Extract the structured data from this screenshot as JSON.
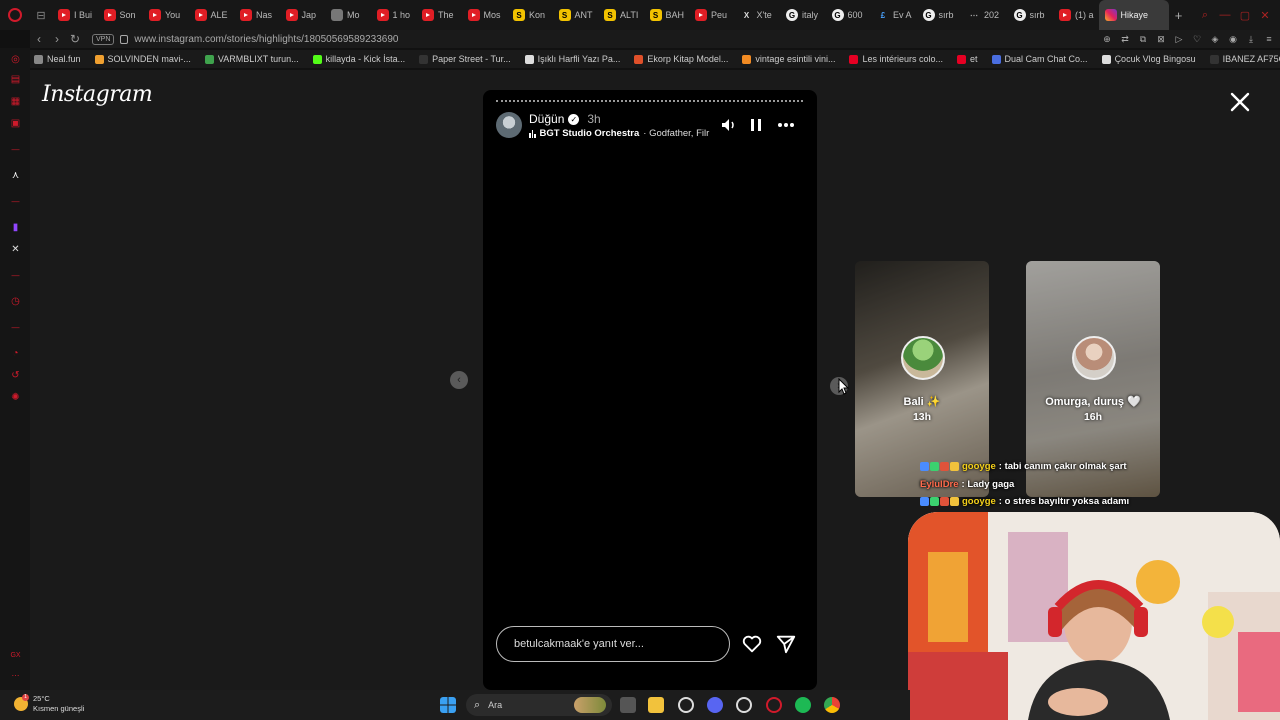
{
  "browser": {
    "tabs": [
      {
        "icon": "youtube-icon",
        "label": "I Bui"
      },
      {
        "icon": "youtube-icon",
        "label": "Son"
      },
      {
        "icon": "youtube-icon",
        "label": "You"
      },
      {
        "icon": "youtube-icon",
        "label": "ALE"
      },
      {
        "icon": "youtube-icon",
        "label": "Nas"
      },
      {
        "icon": "youtube-icon",
        "label": "Jap"
      },
      {
        "icon": "image-icon",
        "label": "Mo"
      },
      {
        "icon": "youtube-icon",
        "label": "1 ho"
      },
      {
        "icon": "youtube-icon",
        "label": "The"
      },
      {
        "icon": "youtube-icon",
        "label": "Mos"
      },
      {
        "icon": "s-icon",
        "label": "Kon"
      },
      {
        "icon": "s-icon",
        "label": "ANT"
      },
      {
        "icon": "s-icon",
        "label": "ALTI"
      },
      {
        "icon": "s-icon",
        "label": "BAH"
      },
      {
        "icon": "youtube-icon",
        "label": "Peu"
      },
      {
        "icon": "x-icon",
        "label": "X'te"
      },
      {
        "icon": "google-icon",
        "label": "italy"
      },
      {
        "icon": "google-icon",
        "label": "600"
      },
      {
        "icon": "ev-icon",
        "label": "Ev A"
      },
      {
        "icon": "google-icon",
        "label": "sırb"
      },
      {
        "icon": "dots-icon",
        "label": "202"
      },
      {
        "icon": "google-icon",
        "label": "sırb"
      },
      {
        "icon": "youtube-icon",
        "label": "(1) a"
      },
      {
        "icon": "instagram-icon",
        "label": "Hikaye",
        "active": true
      }
    ],
    "address": {
      "vpn_label": "VPN",
      "url": "www.instagram.com/stories/highlights/18050569589233690"
    },
    "bookmarks": [
      {
        "label": "Neal.fun",
        "color": "#888888"
      },
      {
        "label": "SOLVINDEN mavi-...",
        "color": "#f0a030"
      },
      {
        "label": "VARMBLIXT turun...",
        "color": "#3fa34d"
      },
      {
        "label": "killayda - Kick İsta...",
        "color": "#53fc18"
      },
      {
        "label": "Paper Street - Tur...",
        "color": "#333333"
      },
      {
        "label": "Işıklı Harfli Yazı Pa...",
        "color": "#dddddd"
      },
      {
        "label": "Ekorp Kitap Model...",
        "color": "#e0502a"
      },
      {
        "label": "vintage esintili vini...",
        "color": "#f28b23"
      },
      {
        "label": "Les intérieurs colo...",
        "color": "#e60023"
      },
      {
        "label": "et",
        "color": "#e60023"
      },
      {
        "label": "Dual Cam Chat Co...",
        "color": "#4a6ee0"
      },
      {
        "label": "Çocuk Vlog Bingosu",
        "color": "#dddddd"
      },
      {
        "label": "IBANEZ AF75G-B...",
        "color": "#333333"
      }
    ]
  },
  "instagram": {
    "logo": "Instagram",
    "story": {
      "title": "Düğün",
      "time": "3h",
      "music_artist": "BGT Studio Orchestra",
      "music_title": "· Godfather, Filr",
      "reply_placeholder": "betulcakmaak'e yanıt ver..."
    },
    "next_highlights": [
      {
        "label": "Bali ✨",
        "time": "13h"
      },
      {
        "label": "Omurga, duruş 🤍",
        "time": "16h"
      }
    ]
  },
  "chat": [
    {
      "user": "gooyge",
      "message": ": tabi canım çakır olmak şart",
      "color": "#f5d11b",
      "badges": true
    },
    {
      "user": "EylulDre",
      "message": ": Lady gaga",
      "color": "#ff6a4c",
      "badges": false
    },
    {
      "user": "gooyge",
      "message": ": o stres bayıltır yoksa adamı",
      "color": "#f5d11b",
      "badges": true
    }
  ],
  "taskbar": {
    "weather_temp": "25°C",
    "weather_desc": "Kısmen güneşli",
    "weather_badge": "1",
    "search_label": "Ara"
  },
  "colors": {
    "accent": "#d01a2b",
    "background": "#1a1a1a"
  }
}
